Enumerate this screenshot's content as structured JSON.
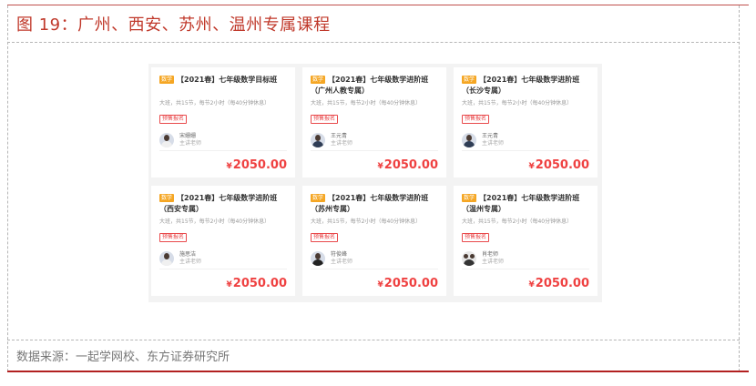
{
  "figure": {
    "title": "图 19：广州、西安、苏州、温州专属课程",
    "source": "数据来源：一起学网校、东方证券研究所"
  },
  "colors": {
    "accent": "#c0392b",
    "price": "#ef4141",
    "tag": "#f5a623"
  },
  "cards": [
    {
      "tag": "数学",
      "title": "【2021春】七年级数学目标班",
      "meta": "大班，共15节，每节2小时（每40分钟休息）",
      "badge": "预售报名",
      "teacher": "宋姗姗",
      "role": "主讲老师",
      "currency": "¥",
      "price": "2050.00",
      "avatar_icon": "teacher-photo-icon"
    },
    {
      "tag": "数学",
      "title": "【2021春】七年级数学进阶班（广州人教专属）",
      "meta": "大班，共15节，每节2小时（每40分钟休息）",
      "badge": "预售报名",
      "teacher": "王元青",
      "role": "主讲老师",
      "currency": "¥",
      "price": "2050.00",
      "avatar_icon": "teacher-photo-icon"
    },
    {
      "tag": "数学",
      "title": "【2021春】七年级数学进阶班（长沙专属）",
      "meta": "大班，共15节，每节2小时（每40分钟休息）",
      "badge": "预售报名",
      "teacher": "王元青",
      "role": "主讲老师",
      "currency": "¥",
      "price": "2050.00",
      "avatar_icon": "teacher-photo-icon"
    },
    {
      "tag": "数学",
      "title": "【2021春】七年级数学进阶班（西安专属）",
      "meta": "大班，共15节，每节2小时（每40分钟休息）",
      "badge": "预售报名",
      "teacher": "施思洁",
      "role": "主讲老师",
      "currency": "¥",
      "price": "2050.00",
      "avatar_icon": "teacher-photo-icon"
    },
    {
      "tag": "数学",
      "title": "【2021春】七年级数学进阶班（苏州专属）",
      "meta": "大班，共15节，每节2小时（每40分钟休息）",
      "badge": "预售报名",
      "teacher": "符俊峰",
      "role": "主讲老师",
      "currency": "¥",
      "price": "2050.00",
      "avatar_icon": "teacher-photo-icon"
    },
    {
      "tag": "数学",
      "title": "【2021春】七年级数学进阶班（温州专属）",
      "meta": "大班，共15节，每节2小时（每40分钟休息）",
      "badge": "预售报名",
      "teacher": "肖老师",
      "role": "主讲老师",
      "currency": "¥",
      "price": "2050.00",
      "avatar_icon": "teacher-group-photo-icon"
    }
  ]
}
